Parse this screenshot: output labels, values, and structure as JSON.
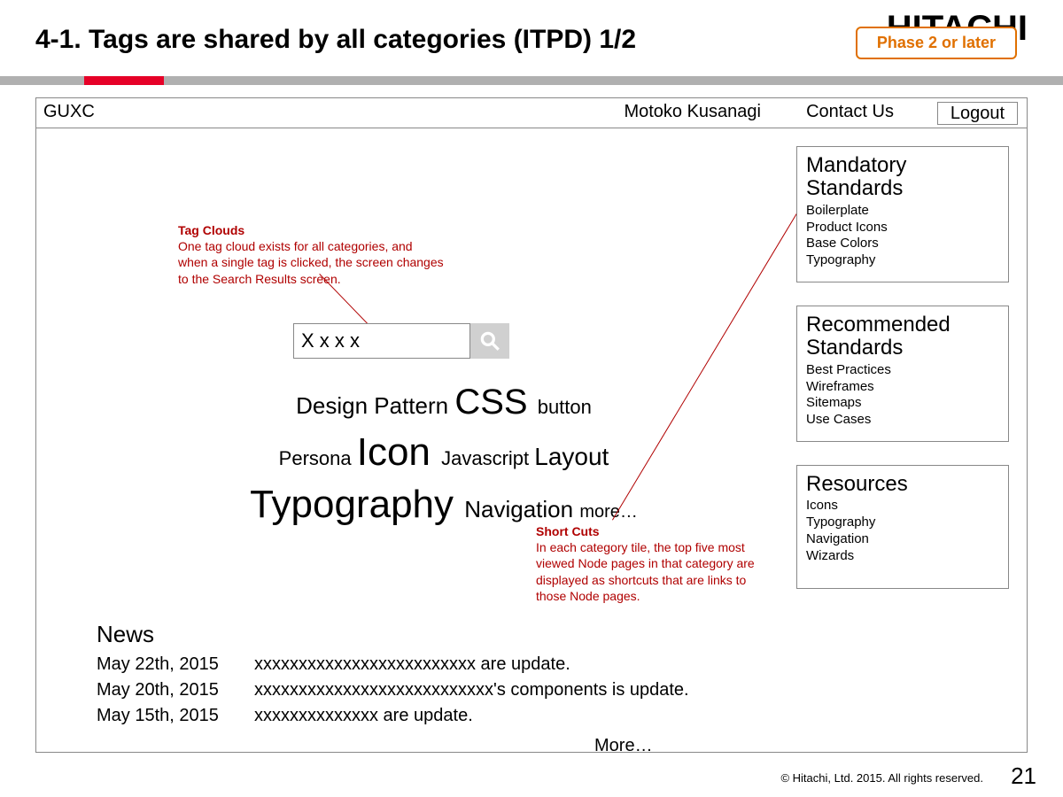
{
  "slide": {
    "title": "4-1. Tags are shared by all categories (ITPD) 1/2",
    "phase_badge": "Phase 2 or later",
    "brand_bg": "HITACHI",
    "page_number": "21",
    "copyright": "© Hitachi, Ltd. 2015. All rights reserved."
  },
  "header": {
    "brand": "GUXC",
    "user": "Motoko Kusanagi",
    "contact": "Contact Us",
    "logout": "Logout"
  },
  "search": {
    "value": "X x x x"
  },
  "tag_cloud": {
    "row1": {
      "a": "Design Pattern ",
      "b": "CSS ",
      "c": "button"
    },
    "row2": {
      "a": "Persona ",
      "b": "Icon ",
      "c": "Javascript ",
      "d": "Layout"
    },
    "row3": {
      "a": "Typography ",
      "b": "Navigation ",
      "c": "more…"
    }
  },
  "callouts": {
    "tag": {
      "title": "Tag Clouds",
      "body": "One tag cloud exists for all categories, and when a single tag is clicked, the screen changes to the Search Results screen."
    },
    "short": {
      "title": "Short Cuts",
      "body": "In each category tile, the top five most viewed Node pages in that category are displayed as shortcuts that are links to those Node pages."
    }
  },
  "categories": [
    {
      "title": "Mandatory Standards",
      "items": [
        "Boilerplate",
        "Product Icons",
        "Base Colors",
        "Typography"
      ]
    },
    {
      "title": "Recommended Standards",
      "items": [
        "Best Practices",
        "Wireframes",
        "Sitemaps",
        "Use Cases"
      ]
    },
    {
      "title": "Resources",
      "items": [
        "Icons",
        "Typography",
        "Navigation",
        "Wizards"
      ]
    }
  ],
  "news": {
    "heading": "News",
    "items": [
      {
        "date": "May 22th, 2015",
        "text": "xxxxxxxxxxxxxxxxxxxxxxxxx are update."
      },
      {
        "date": "May 20th, 2015",
        "text": "xxxxxxxxxxxxxxxxxxxxxxxxxxx's components is update."
      },
      {
        "date": "May 15th, 2015",
        "text": "xxxxxxxxxxxxxx are update."
      }
    ],
    "more": "More…"
  }
}
